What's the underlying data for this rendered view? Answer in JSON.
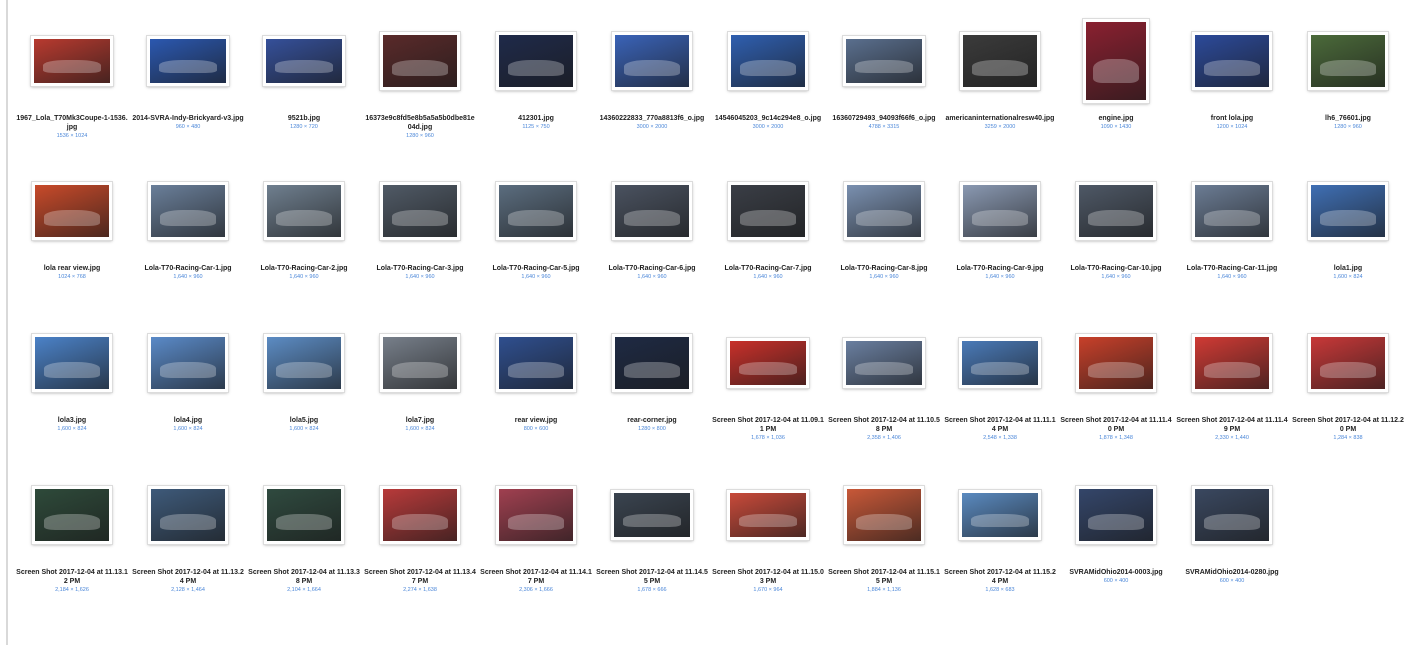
{
  "files": [
    {
      "name": "1967_Lola_T70Mk3Coupe-1-1536.jpg",
      "dims": "1536 × 1024",
      "color": "#b83a2f",
      "shape": "wide"
    },
    {
      "name": "2014-SVRA-Indy-Brickyard-v3.jpg",
      "dims": "960 × 480",
      "color": "#2b58b0",
      "shape": "wide"
    },
    {
      "name": "9521b.jpg",
      "dims": "1280 × 720",
      "color": "#35509a",
      "shape": "wide"
    },
    {
      "name": "16373e9c8fd5e8b5a5a5b0dbe81e04d.jpg",
      "dims": "1280 × 960",
      "color": "#5a2a2a",
      "shape": "normal"
    },
    {
      "name": "412301.jpg",
      "dims": "1125 × 750",
      "color": "#1f2a4a",
      "shape": "normal"
    },
    {
      "name": "14360222833_770a8813f6_o.jpg",
      "dims": "3000 × 2000",
      "color": "#3a63b8",
      "shape": "normal"
    },
    {
      "name": "14546045203_9c14c294e8_o.jpg",
      "dims": "3000 × 2000",
      "color": "#2f5fb0",
      "shape": "normal"
    },
    {
      "name": "16360729493_94093f66f6_o.jpg",
      "dims": "4788 × 3315",
      "color": "#5a6f8e",
      "shape": "wide"
    },
    {
      "name": "americaninternationalresw40.jpg",
      "dims": "3259 × 2000",
      "color": "#3b3b3b",
      "shape": "normal"
    },
    {
      "name": "engine.jpg",
      "dims": "1090 × 1430",
      "color": "#8a2030",
      "shape": "tall"
    },
    {
      "name": "front lola.jpg",
      "dims": "1200 × 1024",
      "color": "#2c4a9a",
      "shape": "normal"
    },
    {
      "name": "lh6_76601.jpg",
      "dims": "1280 × 960",
      "color": "#4b6a3a",
      "shape": "normal"
    },
    {
      "name": "lola rear view.jpg",
      "dims": "1024 × 768",
      "color": "#c84a2a",
      "shape": "normal"
    },
    {
      "name": "Lola-T70-Racing-Car-1.jpg",
      "dims": "1,640 × 960",
      "color": "#6a7f9a",
      "shape": "normal"
    },
    {
      "name": "Lola-T70-Racing-Car-2.jpg",
      "dims": "1,640 × 960",
      "color": "#6f7f8f",
      "shape": "normal"
    },
    {
      "name": "Lola-T70-Racing-Car-3.jpg",
      "dims": "1,640 × 960",
      "color": "#505a66",
      "shape": "normal"
    },
    {
      "name": "Lola-T70-Racing-Car-5.jpg",
      "dims": "1,640 × 960",
      "color": "#5b6d7f",
      "shape": "normal"
    },
    {
      "name": "Lola-T70-Racing-Car-6.jpg",
      "dims": "1,640 × 960",
      "color": "#4a5260",
      "shape": "normal"
    },
    {
      "name": "Lola-T70-Racing-Car-7.jpg",
      "dims": "1,640 × 960",
      "color": "#3a3e46",
      "shape": "normal"
    },
    {
      "name": "Lola-T70-Racing-Car-8.jpg",
      "dims": "1,640 × 960",
      "color": "#7a90b0",
      "shape": "normal"
    },
    {
      "name": "Lola-T70-Racing-Car-9.jpg",
      "dims": "1,640 × 960",
      "color": "#8a99b2",
      "shape": "normal"
    },
    {
      "name": "Lola-T70-Racing-Car-10.jpg",
      "dims": "1,640 × 960",
      "color": "#4e5866",
      "shape": "normal"
    },
    {
      "name": "Lola-T70-Racing-Car-11.jpg",
      "dims": "1,640 × 960",
      "color": "#6b7c94",
      "shape": "normal"
    },
    {
      "name": "lola1.jpg",
      "dims": "1,600 × 824",
      "color": "#3f6fb4",
      "shape": "normal"
    },
    {
      "name": "lola3.jpg",
      "dims": "1,600 × 824",
      "color": "#4b82c8",
      "shape": "normal"
    },
    {
      "name": "lola4.jpg",
      "dims": "1,600 × 824",
      "color": "#5a8ac8",
      "shape": "normal"
    },
    {
      "name": "lola5.jpg",
      "dims": "1,600 × 824",
      "color": "#5c8cc4",
      "shape": "normal"
    },
    {
      "name": "lola7.jpg",
      "dims": "1,600 × 824",
      "color": "#777f8a",
      "shape": "normal"
    },
    {
      "name": "rear view.jpg",
      "dims": "800 × 600",
      "color": "#2f4f8f",
      "shape": "normal"
    },
    {
      "name": "rear-corner.jpg",
      "dims": "1280 × 800",
      "color": "#1e2a44",
      "shape": "normal"
    },
    {
      "name": "Screen Shot 2017-12-04 at 11.09.11 PM",
      "dims": "1,678 × 1,036",
      "color": "#c8302a",
      "shape": "wide"
    },
    {
      "name": "Screen Shot 2017-12-04 at 11.10.58 PM",
      "dims": "2,358 × 1,406",
      "color": "#6a7fa0",
      "shape": "wide"
    },
    {
      "name": "Screen Shot 2017-12-04 at 11.11.14 PM",
      "dims": "2,548 × 1,338",
      "color": "#4a7ab8",
      "shape": "wide"
    },
    {
      "name": "Screen Shot 2017-12-04 at 11.11.40 PM",
      "dims": "1,878 × 1,348",
      "color": "#c8402a",
      "shape": "normal"
    },
    {
      "name": "Screen Shot 2017-12-04 at 11.11.49 PM",
      "dims": "2,330 × 1,440",
      "color": "#d03a34",
      "shape": "normal"
    },
    {
      "name": "Screen Shot 2017-12-04 at 11.12.20 PM",
      "dims": "1,284 × 838",
      "color": "#c83838",
      "shape": "normal"
    },
    {
      "name": "Screen Shot 2017-12-04 at 11.13.12 PM",
      "dims": "2,184 × 1,626",
      "color": "#2e4a3a",
      "shape": "normal"
    },
    {
      "name": "Screen Shot 2017-12-04 at 11.13.24 PM",
      "dims": "2,128 × 1,464",
      "color": "#3e5a7a",
      "shape": "normal"
    },
    {
      "name": "Screen Shot 2017-12-04 at 11.13.38 PM",
      "dims": "2,104 × 1,664",
      "color": "#2f4a3f",
      "shape": "normal"
    },
    {
      "name": "Screen Shot 2017-12-04 at 11.13.47 PM",
      "dims": "2,274 × 1,638",
      "color": "#b83a3a",
      "shape": "normal"
    },
    {
      "name": "Screen Shot 2017-12-04 at 11.14.17 PM",
      "dims": "2,306 × 1,666",
      "color": "#a04050",
      "shape": "normal"
    },
    {
      "name": "Screen Shot 2017-12-04 at 11.14.55 PM",
      "dims": "1,678 × 666",
      "color": "#3a4450",
      "shape": "wide"
    },
    {
      "name": "Screen Shot 2017-12-04 at 11.15.03 PM",
      "dims": "1,670 × 964",
      "color": "#c84a3a",
      "shape": "wide"
    },
    {
      "name": "Screen Shot 2017-12-04 at 11.15.15 PM",
      "dims": "1,884 × 1,136",
      "color": "#c85838",
      "shape": "normal"
    },
    {
      "name": "Screen Shot 2017-12-04 at 11.15.24 PM",
      "dims": "1,628 × 683",
      "color": "#5a8ac0",
      "shape": "wide"
    },
    {
      "name": "SVRAMidOhio2014-0003.jpg",
      "dims": "600 × 400",
      "color": "#34466a",
      "shape": "normal"
    },
    {
      "name": "SVRAMidOhio2014-0280.jpg",
      "dims": "600 × 400",
      "color": "#3a4860",
      "shape": "normal"
    }
  ]
}
